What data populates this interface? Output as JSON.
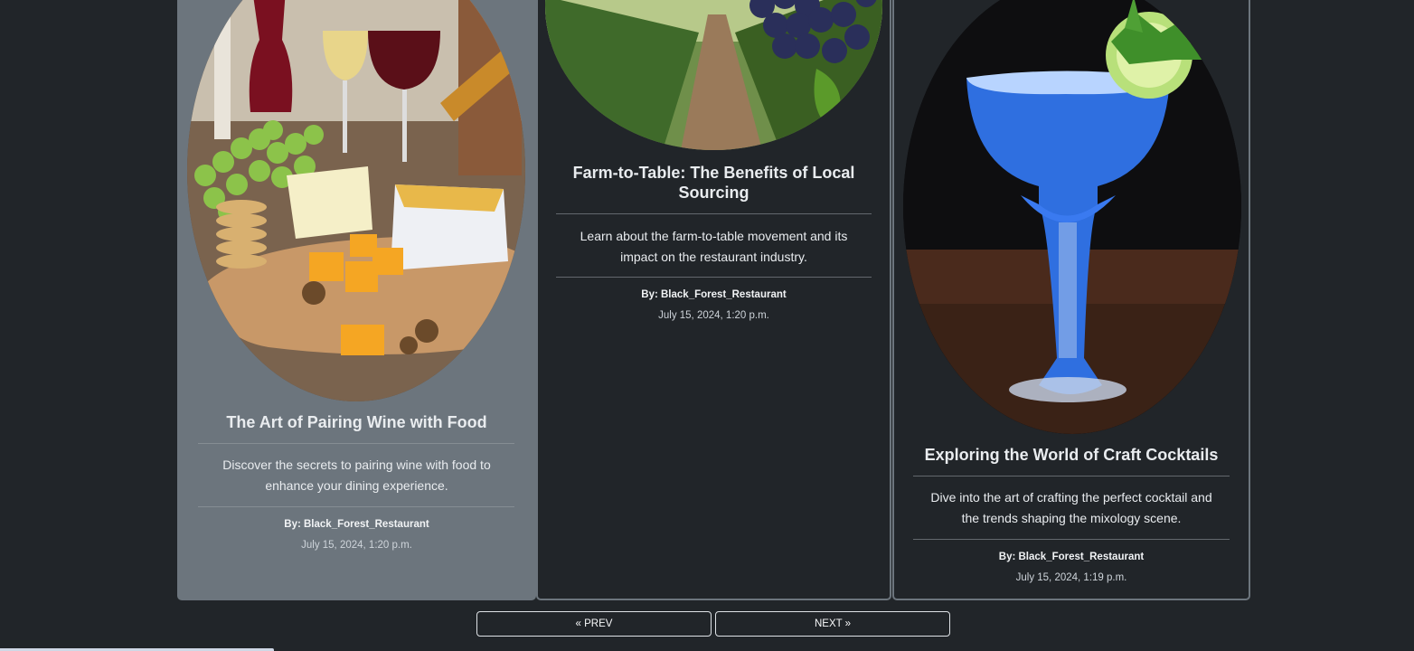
{
  "posts": [
    {
      "title": "The Art of Pairing Wine with Food",
      "description": "Discover the secrets to pairing wine with food to enhance your dining experience.",
      "author": "By: Black_Forest_Restaurant",
      "date": "July 15, 2024, 1:20 p.m."
    },
    {
      "title": "Farm-to-Table: The Benefits of Local Sourcing",
      "description": "Learn about the farm-to-table movement and its impact on the restaurant industry.",
      "author": "By: Black_Forest_Restaurant",
      "date": "July 15, 2024, 1:20 p.m."
    },
    {
      "title": "Exploring the World of Craft Cocktails",
      "description": "Dive into the art of crafting the perfect cocktail and the trends shaping the mixology scene.",
      "author": "By: Black_Forest_Restaurant",
      "date": "July 15, 2024, 1:19 p.m."
    }
  ],
  "pagination": {
    "prev_label": "« PREV",
    "next_label": "NEXT »"
  },
  "colors": {
    "page_bg": "#212529",
    "hover_card_bg": "#6c757d",
    "card_border": "#6c757d",
    "text": "#e9ecef"
  }
}
